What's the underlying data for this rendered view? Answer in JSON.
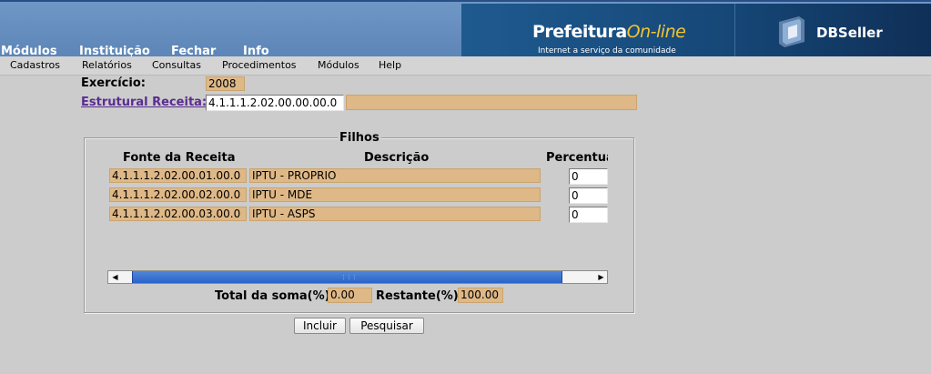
{
  "banner": {
    "brand_main": "Prefeitura",
    "brand_accent": "On-line",
    "brand_tagline": "Internet a serviço da comunidade",
    "vendor": "DBSeller"
  },
  "top_menu": [
    "Módulos",
    "Instituição",
    "Fechar",
    "Info"
  ],
  "menubar": [
    "Cadastros",
    "Relatórios",
    "Consultas",
    "Procedimentos",
    "Módulos",
    "Help"
  ],
  "form": {
    "exercicio_label": "Exercício:",
    "exercicio_value": "2008",
    "estrutural_label": "Estrutural Receita:",
    "estrutural_value": "4.1.1.1.2.02.00.00.00.0",
    "estrutural_desc": ""
  },
  "filhos": {
    "legend": "Filhos",
    "columns": [
      "Fonte da Receita",
      "Descrição",
      "Percentua"
    ],
    "rows": [
      {
        "fonte": "4.1.1.1.2.02.00.01.00.0",
        "descricao": "IPTU - PROPRIO",
        "percentual": "0"
      },
      {
        "fonte": "4.1.1.1.2.02.00.02.00.0",
        "descricao": "IPTU - MDE",
        "percentual": "0"
      },
      {
        "fonte": "4.1.1.1.2.02.00.03.00.0",
        "descricao": "IPTU - ASPS",
        "percentual": "0"
      }
    ],
    "total_label": "Total da soma(%)",
    "total_value": "0.00",
    "restante_label": "Restante(%)",
    "restante_value": "100.00"
  },
  "buttons": {
    "incluir": "Incluir",
    "pesquisar": "Pesquisar"
  },
  "colors": {
    "readonly_bg": "#deb887",
    "link": "#5a2d91",
    "banner": "#5d86b8",
    "scroll_thumb": "#2a63c8"
  }
}
